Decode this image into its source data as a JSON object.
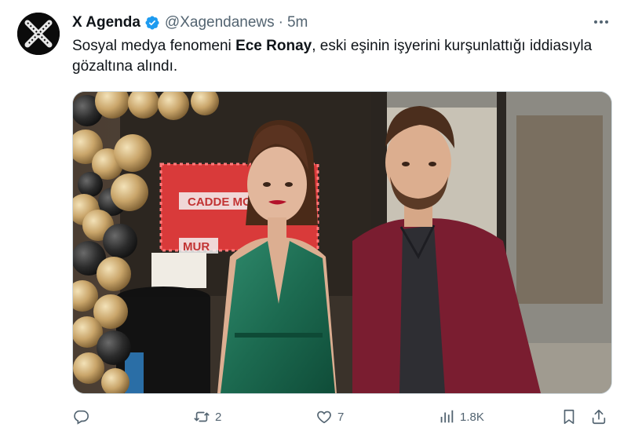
{
  "tweet": {
    "author": {
      "name": "X Agenda",
      "handle": "@Xagendanews",
      "separator": "·",
      "time": "5m",
      "avatar": "x-agenda-avatar",
      "verified_color": "#1d9bf0"
    },
    "text": {
      "part1": "Sosyal medya fenomeni ",
      "bold": "Ece Ronay",
      "part2": ", eski eşinin işyerini kurşunlattığı iddiasıyla gözaltına alındı."
    },
    "media": {
      "description": "photo",
      "sign_text_1": "CADDE MO",
      "sign_text_2": "MUR"
    },
    "actions": {
      "reply_count": "",
      "retweet_count": "2",
      "like_count": "7",
      "views_count": "1.8K"
    }
  },
  "colors": {
    "text": "#0f1419",
    "muted": "#536471",
    "accent": "#1d9bf0"
  }
}
